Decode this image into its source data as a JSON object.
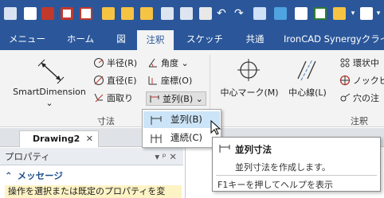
{
  "ribbon_tabs": [
    "メニュー",
    "ホーム",
    "図",
    "注釈",
    "スケッチ",
    "共通",
    "IronCAD Synergyクライ"
  ],
  "active_tab": "注釈",
  "dimension_group": {
    "smart_dimension_label": "SmartDimension",
    "radius_label": "半径(R)",
    "diameter_label": "直径(E)",
    "chamfer_label": "面取り",
    "angle_label": "角度",
    "coordinate_label": "座標(O)",
    "parallel_label": "並列(B)",
    "group_label": "寸法"
  },
  "center_group": {
    "center_mark_label": "中心マーク(M)",
    "center_line_label": "中心線(L)",
    "ring_label": "環状中",
    "knock_label": "ノックピ",
    "hole_label": "穴の注",
    "group_label": "注釈"
  },
  "document_tab": "Drawing2",
  "properties_panel": {
    "title": "プロパティ",
    "pin_symbol": "▾ ᵖ ✕",
    "message_heading": "メッセージ",
    "message_text": "操作を選択または既定のプロパティを変"
  },
  "dropdown": {
    "items": [
      "並列(B)",
      "連続(C)"
    ]
  },
  "tooltip": {
    "title": "並列寸法",
    "description": "並列寸法を作成します。",
    "help": "F1キーを押してヘルプを表示"
  },
  "colors": {
    "ribbon_blue": "#2b579a",
    "highlight": "#cce4f7",
    "message_bg": "#fdf3c5"
  }
}
